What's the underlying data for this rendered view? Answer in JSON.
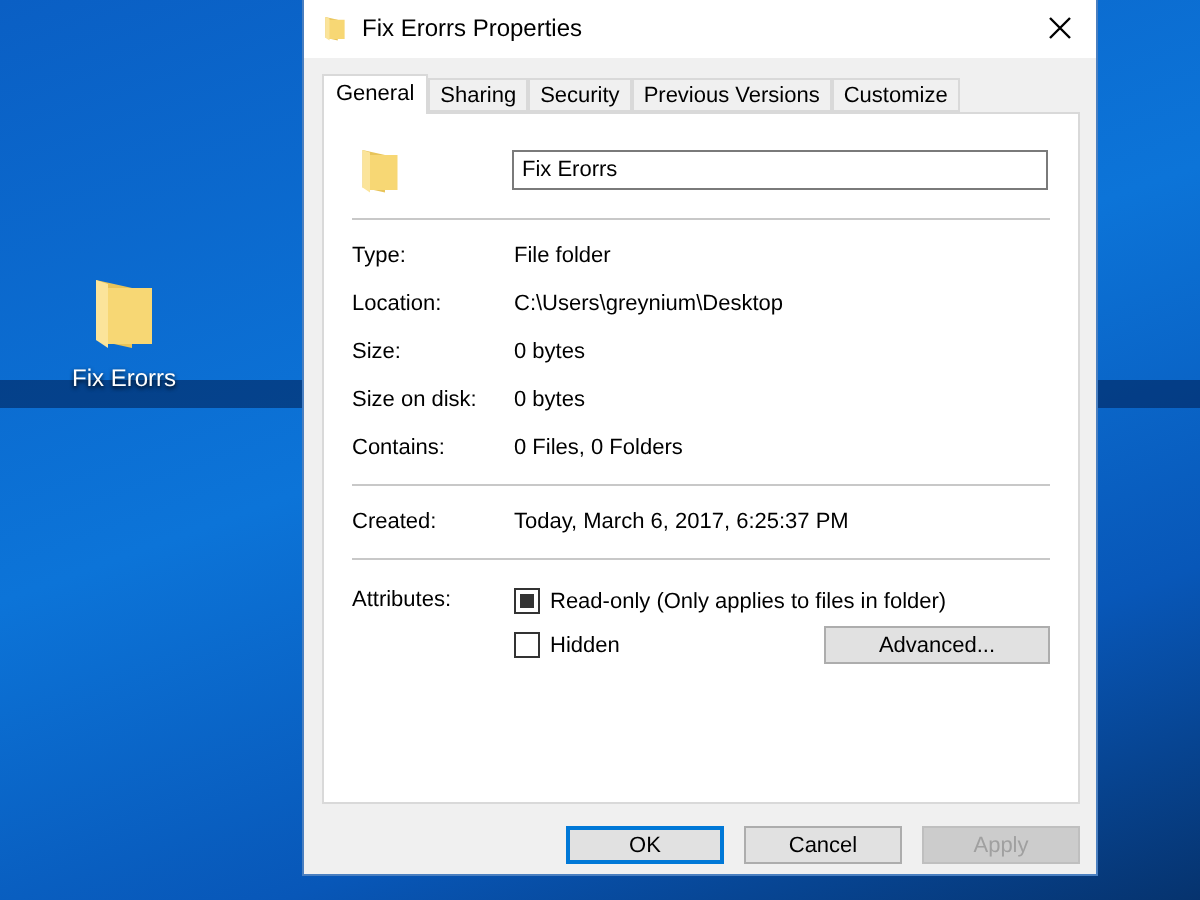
{
  "desktop_icon": {
    "label": "Fix Erorrs"
  },
  "window": {
    "title": "Fix Erorrs Properties"
  },
  "tabs": [
    {
      "label": "General",
      "selected": true
    },
    {
      "label": "Sharing",
      "selected": false
    },
    {
      "label": "Security",
      "selected": false
    },
    {
      "label": "Previous Versions",
      "selected": false
    },
    {
      "label": "Customize",
      "selected": false
    }
  ],
  "name_field": {
    "value": "Fix Erorrs"
  },
  "info_groups": [
    [
      {
        "label": "Type:",
        "value": "File folder"
      },
      {
        "label": "Location:",
        "value": "C:\\Users\\greynium\\Desktop"
      },
      {
        "label": "Size:",
        "value": "0 bytes"
      },
      {
        "label": "Size on disk:",
        "value": "0 bytes"
      },
      {
        "label": "Contains:",
        "value": "0 Files, 0 Folders"
      }
    ],
    [
      {
        "label": "Created:",
        "value": "Today, March 6, 2017, 6:25:37 PM"
      }
    ]
  ],
  "attributes": {
    "label": "Attributes:",
    "items": [
      {
        "label": "Read-only (Only applies to files in folder)",
        "checked": false,
        "indeterminate": true
      },
      {
        "label": "Hidden",
        "checked": false,
        "indeterminate": false
      }
    ],
    "advanced_button": "Advanced..."
  },
  "buttons": [
    {
      "label": "OK",
      "default": true,
      "disabled": false
    },
    {
      "label": "Cancel",
      "default": false,
      "disabled": false
    },
    {
      "label": "Apply",
      "default": false,
      "disabled": true
    }
  ]
}
